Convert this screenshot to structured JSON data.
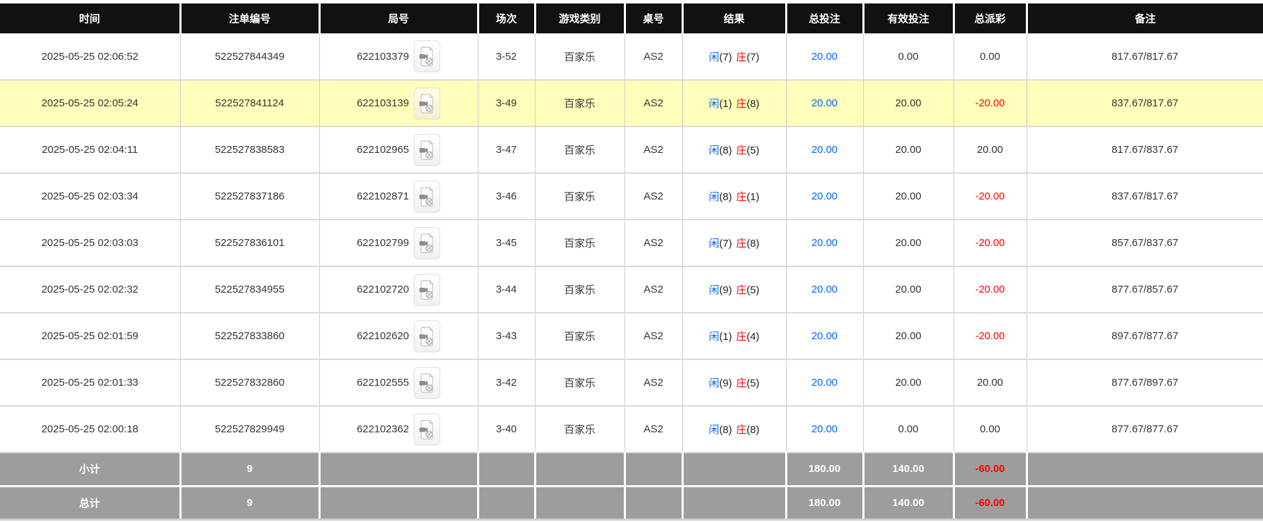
{
  "colors": {
    "accent_blue": "#0066ff",
    "accent_red": "#ff0000",
    "highlight_yellow": "#ffffbb",
    "header_bg": "#111111",
    "summary_bg": "#9d9d9d"
  },
  "table": {
    "columns": [
      "时间",
      "注单编号",
      "局号",
      "场次",
      "游戏类别",
      "桌号",
      "结果",
      "总投注",
      "有效投注",
      "总派彩",
      "备注"
    ],
    "rows": [
      {
        "time": "2025-05-25 02:06:52",
        "bet_no": "522527844349",
        "round_no": "622103379",
        "session": "3-52",
        "game_type": "百家乐",
        "table_no": "AS2",
        "result": {
          "player": "闲",
          "player_num": "(7)",
          "banker": "庄",
          "banker_num": "(7)"
        },
        "total_bet": "20.00",
        "valid_bet": "0.00",
        "payout": "0.00",
        "remark": "817.67/817.67",
        "highlighted": false
      },
      {
        "time": "2025-05-25 02:05:24",
        "bet_no": "522527841124",
        "round_no": "622103139",
        "session": "3-49",
        "game_type": "百家乐",
        "table_no": "AS2",
        "result": {
          "player": "闲",
          "player_num": "(1)",
          "banker": "庄",
          "banker_num": "(8)"
        },
        "total_bet": "20.00",
        "valid_bet": "20.00",
        "payout": "-20.00",
        "remark": "837.67/817.67",
        "highlighted": true
      },
      {
        "time": "2025-05-25 02:04:11",
        "bet_no": "522527838583",
        "round_no": "622102965",
        "session": "3-47",
        "game_type": "百家乐",
        "table_no": "AS2",
        "result": {
          "player": "闲",
          "player_num": "(8)",
          "banker": "庄",
          "banker_num": "(5)"
        },
        "total_bet": "20.00",
        "valid_bet": "20.00",
        "payout": "20.00",
        "remark": "817.67/837.67",
        "highlighted": false
      },
      {
        "time": "2025-05-25 02:03:34",
        "bet_no": "522527837186",
        "round_no": "622102871",
        "session": "3-46",
        "game_type": "百家乐",
        "table_no": "AS2",
        "result": {
          "player": "闲",
          "player_num": "(8)",
          "banker": "庄",
          "banker_num": "(1)"
        },
        "total_bet": "20.00",
        "valid_bet": "20.00",
        "payout": "-20.00",
        "remark": "837.67/817.67",
        "highlighted": false
      },
      {
        "time": "2025-05-25 02:03:03",
        "bet_no": "522527836101",
        "round_no": "622102799",
        "session": "3-45",
        "game_type": "百家乐",
        "table_no": "AS2",
        "result": {
          "player": "闲",
          "player_num": "(7)",
          "banker": "庄",
          "banker_num": "(8)"
        },
        "total_bet": "20.00",
        "valid_bet": "20.00",
        "payout": "-20.00",
        "remark": "857.67/837.67",
        "highlighted": false
      },
      {
        "time": "2025-05-25 02:02:32",
        "bet_no": "522527834955",
        "round_no": "622102720",
        "session": "3-44",
        "game_type": "百家乐",
        "table_no": "AS2",
        "result": {
          "player": "闲",
          "player_num": "(9)",
          "banker": "庄",
          "banker_num": "(5)"
        },
        "total_bet": "20.00",
        "valid_bet": "20.00",
        "payout": "-20.00",
        "remark": "877.67/857.67",
        "highlighted": false
      },
      {
        "time": "2025-05-25 02:01:59",
        "bet_no": "522527833860",
        "round_no": "622102620",
        "session": "3-43",
        "game_type": "百家乐",
        "table_no": "AS2",
        "result": {
          "player": "闲",
          "player_num": "(1)",
          "banker": "庄",
          "banker_num": "(4)"
        },
        "total_bet": "20.00",
        "valid_bet": "20.00",
        "payout": "-20.00",
        "remark": "897.67/877.67",
        "highlighted": false
      },
      {
        "time": "2025-05-25 02:01:33",
        "bet_no": "522527832860",
        "round_no": "622102555",
        "session": "3-42",
        "game_type": "百家乐",
        "table_no": "AS2",
        "result": {
          "player": "闲",
          "player_num": "(9)",
          "banker": "庄",
          "banker_num": "(5)"
        },
        "total_bet": "20.00",
        "valid_bet": "20.00",
        "payout": "20.00",
        "remark": "877.67/897.67",
        "highlighted": false
      },
      {
        "time": "2025-05-25 02:00:18",
        "bet_no": "522527829949",
        "round_no": "622102362",
        "session": "3-40",
        "game_type": "百家乐",
        "table_no": "AS2",
        "result": {
          "player": "闲",
          "player_num": "(8)",
          "banker": "庄",
          "banker_num": "(8)"
        },
        "total_bet": "20.00",
        "valid_bet": "0.00",
        "payout": "0.00",
        "remark": "877.67/877.67",
        "highlighted": false
      }
    ]
  },
  "summary": {
    "subtotal": {
      "label": "小计",
      "count": "9",
      "total_bet": "180.00",
      "valid_bet": "140.00",
      "payout": "-60.00"
    },
    "total": {
      "label": "总计",
      "count": "9",
      "total_bet": "180.00",
      "valid_bet": "140.00",
      "payout": "-60.00"
    }
  }
}
